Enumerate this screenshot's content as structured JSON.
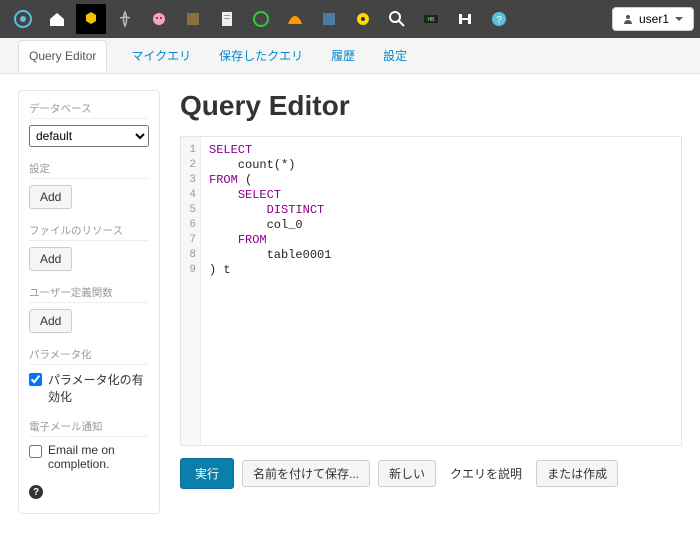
{
  "topbar": {
    "icons": [
      "logo",
      "home",
      "beeswax",
      "impala",
      "pig",
      "oozie",
      "filebrowser",
      "jobbrowser",
      "metastore",
      "spark",
      "sqoop",
      "search",
      "hbase",
      "hdfs",
      "help"
    ],
    "user_label": "user1"
  },
  "subtabs": {
    "items": [
      {
        "label": "Query Editor",
        "active": true
      },
      {
        "label": "マイクエリ"
      },
      {
        "label": "保存したクエリ"
      },
      {
        "label": "履歴"
      },
      {
        "label": "設定"
      }
    ]
  },
  "sidebar": {
    "database": {
      "title": "データベース",
      "selected": "default"
    },
    "settings": {
      "title": "設定",
      "add": "Add"
    },
    "file_resources": {
      "title": "ファイルのリソース",
      "add": "Add"
    },
    "udf": {
      "title": "ユーザー定義関数",
      "add": "Add"
    },
    "parameterize": {
      "title": "パラメータ化",
      "label": "パラメータ化の有効化",
      "checked": true
    },
    "email": {
      "title": "電子メール通知",
      "label": "Email me on completion.",
      "checked": false
    }
  },
  "page": {
    "title": "Query Editor"
  },
  "editor": {
    "line_numbers": [
      "1",
      "2",
      "3",
      "4",
      "5",
      "6",
      "7",
      "8",
      "9"
    ],
    "tokens": [
      [
        {
          "t": "SELECT",
          "kw": true
        }
      ],
      [
        {
          "t": "    count(*)"
        }
      ],
      [
        {
          "t": "FROM",
          "kw": true
        },
        {
          "t": " ("
        }
      ],
      [
        {
          "t": "    "
        },
        {
          "t": "SELECT",
          "kw": true
        }
      ],
      [
        {
          "t": "        "
        },
        {
          "t": "DISTINCT",
          "kw": true
        }
      ],
      [
        {
          "t": "        col_0"
        }
      ],
      [
        {
          "t": "    "
        },
        {
          "t": "FROM",
          "kw": true
        }
      ],
      [
        {
          "t": "        table0001"
        }
      ],
      [
        {
          "t": ") t"
        }
      ]
    ]
  },
  "actions": {
    "execute": "実行",
    "save_as": "名前を付けて保存...",
    "new": "新しい",
    "explain": "クエリを説明",
    "or_create": "または作成"
  }
}
